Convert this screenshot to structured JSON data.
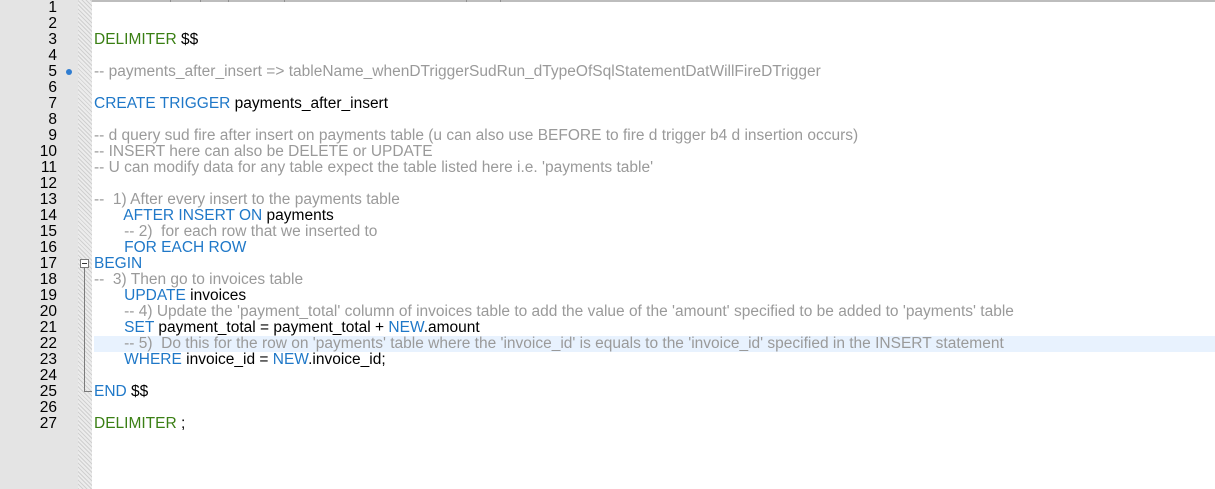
{
  "editor": {
    "lines": [
      {
        "num": "1",
        "tokens": []
      },
      {
        "num": "2",
        "tokens": []
      },
      {
        "num": "3",
        "tokens": [
          {
            "t": "DELIMITER ",
            "c": "green"
          },
          {
            "t": "$$",
            "c": "black"
          }
        ]
      },
      {
        "num": "4",
        "tokens": []
      },
      {
        "num": "5",
        "mark": true,
        "tokens": [
          {
            "t": "-- payments_after_insert => tableName_whenDTriggerSudRun_dTypeOfSqlStatementDatWillFireDTrigger",
            "c": "gray"
          }
        ]
      },
      {
        "num": "6",
        "tokens": []
      },
      {
        "num": "7",
        "tokens": [
          {
            "t": "CREATE TRIGGER ",
            "c": "blue"
          },
          {
            "t": "payments_after_insert",
            "c": "black"
          }
        ]
      },
      {
        "num": "8",
        "tokens": []
      },
      {
        "num": "9",
        "tokens": [
          {
            "t": "-- d query sud fire after insert on payments table (u can also use BEFORE to fire d trigger b4 d insertion occurs)",
            "c": "gray"
          }
        ]
      },
      {
        "num": "10",
        "tokens": [
          {
            "t": "-- INSERT here can also be DELETE or UPDATE",
            "c": "gray"
          }
        ]
      },
      {
        "num": "11",
        "tokens": [
          {
            "t": "-- U can modify data for any table expect the table listed here i.e. 'payments table'",
            "c": "gray"
          }
        ]
      },
      {
        "num": "12",
        "tokens": []
      },
      {
        "num": "13",
        "tokens": [
          {
            "t": "--  1) After every insert to the payments table",
            "c": "gray"
          }
        ]
      },
      {
        "num": "14",
        "tokens": [
          {
            "t": "       AFTER INSERT ON ",
            "c": "blue"
          },
          {
            "t": "payments",
            "c": "black"
          }
        ]
      },
      {
        "num": "15",
        "tokens": [
          {
            "t": "       -- 2)  for each row that we inserted to",
            "c": "gray"
          }
        ]
      },
      {
        "num": "16",
        "tokens": [
          {
            "t": "       FOR EACH ROW",
            "c": "blue"
          }
        ]
      },
      {
        "num": "17",
        "tokens": [
          {
            "t": "BEGIN",
            "c": "blue"
          }
        ]
      },
      {
        "num": "18",
        "tokens": [
          {
            "t": "--  3) Then go to invoices table",
            "c": "gray"
          }
        ]
      },
      {
        "num": "19",
        "tokens": [
          {
            "t": "       UPDATE ",
            "c": "blue"
          },
          {
            "t": "invoices",
            "c": "black"
          }
        ]
      },
      {
        "num": "20",
        "tokens": [
          {
            "t": "       -- 4) Update the 'payment_total' column of invoices table to add the value of the 'amount' specified to be added to 'payments' table",
            "c": "gray"
          }
        ]
      },
      {
        "num": "21",
        "tokens": [
          {
            "t": "       SET ",
            "c": "blue"
          },
          {
            "t": "payment_total = payment_total + ",
            "c": "black"
          },
          {
            "t": "NEW",
            "c": "blue"
          },
          {
            "t": ".amount",
            "c": "black"
          }
        ]
      },
      {
        "num": "22",
        "highlight": true,
        "tokens": [
          {
            "t": "       -- 5)  Do this for the row on 'payments' table where the 'invoice_id' is equals to the 'invoice_id' specified in the INSERT statement",
            "c": "gray"
          }
        ]
      },
      {
        "num": "23",
        "tokens": [
          {
            "t": "       WHERE ",
            "c": "blue"
          },
          {
            "t": "invoice_id = ",
            "c": "black"
          },
          {
            "t": "NEW",
            "c": "blue"
          },
          {
            "t": ".invoice_id;",
            "c": "black"
          }
        ]
      },
      {
        "num": "24",
        "tokens": []
      },
      {
        "num": "25",
        "tokens": [
          {
            "t": "END ",
            "c": "blue"
          },
          {
            "t": "$$",
            "c": "black"
          }
        ]
      },
      {
        "num": "26",
        "tokens": []
      },
      {
        "num": "27",
        "tokens": [
          {
            "t": "DELIMITER ",
            "c": "green"
          },
          {
            "t": ";",
            "c": "black"
          }
        ]
      }
    ]
  },
  "colors": {
    "keyword_green": "#3a7f14",
    "keyword_blue": "#1f78c8",
    "comment": "#9a9a9a",
    "text": "#000000",
    "current_line": "#e8f2fe",
    "bookmark": "#2f7dd1"
  }
}
